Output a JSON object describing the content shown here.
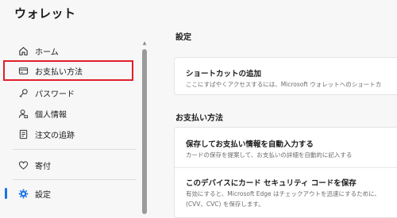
{
  "app": {
    "title": "ウォレット"
  },
  "sidebar": {
    "items": [
      {
        "label": "ホーム",
        "icon": "home-icon"
      },
      {
        "label": "お支払い方法",
        "icon": "credit-card-icon"
      },
      {
        "label": "パスワード",
        "icon": "key-icon"
      },
      {
        "label": "個人情報",
        "icon": "person-icon"
      },
      {
        "label": "注文の追跡",
        "icon": "document-icon"
      },
      {
        "label": "寄付",
        "icon": "heart-icon"
      },
      {
        "label": "設定",
        "icon": "gear-icon"
      }
    ]
  },
  "main": {
    "settings_heading": "設定",
    "shortcut": {
      "title": "ショートカットの追加",
      "desc": "ここにすばやくアクセスするには、Microsoft ウォレットへのショートカ"
    },
    "payment_heading": "お支払い方法",
    "autofill": {
      "title": "保存してお支払い情報を自動入力する",
      "desc": "カードの保存を提案して、お支払いの詳細を自動的に記入する"
    },
    "cvc": {
      "title": "このデバイスにカード セキュリティ コードを保存",
      "desc_line1": "有効にすると、Microsoft Edge はチェックアウトを迅速にするために、",
      "desc_line2": "(CVV、CVC) を保存します。"
    }
  },
  "colors": {
    "highlight": "#e0202a",
    "accent": "#1a73e8"
  }
}
